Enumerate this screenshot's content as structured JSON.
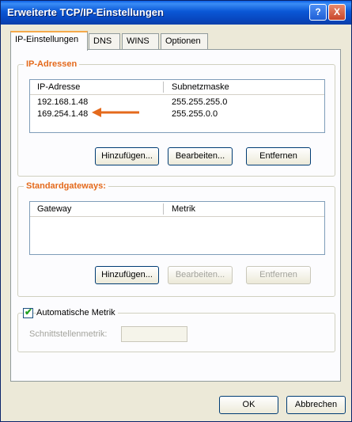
{
  "window": {
    "title": "Erweiterte TCP/IP-Einstellungen",
    "help_label": "?",
    "close_label": "X"
  },
  "tabs": [
    {
      "label": "IP-Einstellungen",
      "active": true
    },
    {
      "label": "DNS"
    },
    {
      "label": "WINS"
    },
    {
      "label": "Optionen"
    }
  ],
  "ip_addresses": {
    "title": "IP-Adressen",
    "columns": [
      "IP-Adresse",
      "Subnetzmaske"
    ],
    "rows": [
      {
        "ip": "192.168.1.48",
        "mask": "255.255.255.0"
      },
      {
        "ip": "169.254.1.48",
        "mask": "255.255.0.0"
      }
    ],
    "buttons": {
      "add": "Hinzufügen...",
      "edit": "Bearbeiten...",
      "remove": "Entfernen"
    }
  },
  "gateways": {
    "title": "Standardgateways:",
    "columns": [
      "Gateway",
      "Metrik"
    ],
    "buttons": {
      "add": "Hinzufügen...",
      "edit": "Bearbeiten...",
      "remove": "Entfernen"
    }
  },
  "metric": {
    "auto_label": "Automatische Metrik",
    "auto_checked": true,
    "interface_label": "Schnittstellenmetrik:",
    "interface_value": ""
  },
  "footer": {
    "ok": "OK",
    "cancel": "Abbrechen"
  },
  "colors": {
    "accent_orange": "#e46a1c",
    "titlebar_blue": "#0a57d6"
  }
}
